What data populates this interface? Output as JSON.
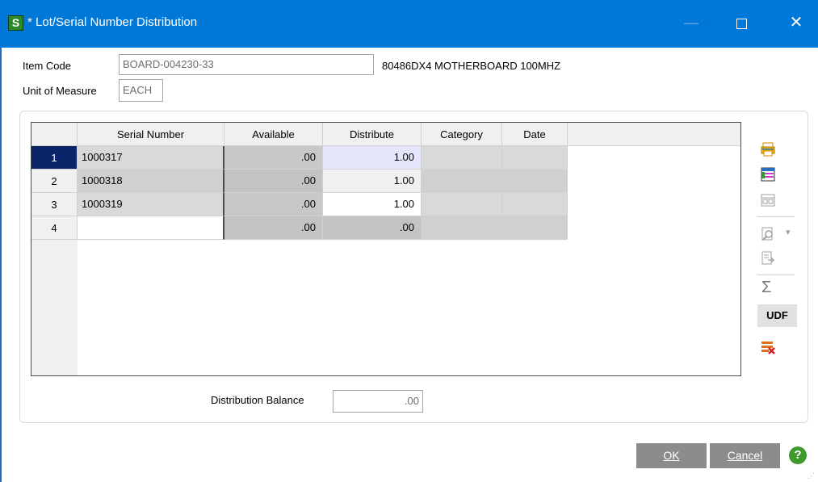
{
  "window": {
    "title": "* Lot/Serial Number Distribution",
    "app_icon_letter": "S",
    "minimize_glyph": "—",
    "close_glyph": "✕"
  },
  "header": {
    "item_code_label": "Item Code",
    "item_code_value": "BOARD-004230-33",
    "item_description": "80486DX4 MOTHERBOARD 100MHZ",
    "uom_label": "Unit of Measure",
    "uom_value": "EACH"
  },
  "grid": {
    "columns": [
      "Serial Number",
      "Available",
      "Distribute",
      "Category",
      "Date"
    ],
    "rows": [
      {
        "num": "1",
        "serial": "1000317",
        "available": ".00",
        "distribute": "1.00",
        "category": "",
        "date": ""
      },
      {
        "num": "2",
        "serial": "1000318",
        "available": ".00",
        "distribute": "1.00",
        "category": "",
        "date": ""
      },
      {
        "num": "3",
        "serial": "1000319",
        "available": ".00",
        "distribute": "1.00",
        "category": "",
        "date": ""
      },
      {
        "num": "4",
        "serial": "",
        "available": ".00",
        "distribute": ".00",
        "category": "",
        "date": ""
      }
    ],
    "selected_row": 1
  },
  "toolbar": {
    "icons": [
      "print-icon",
      "insert-rows-icon",
      "grid-layout-icon",
      "zoom-icon",
      "dropdown-arrow-icon",
      "export-icon",
      "totals-icon",
      "delete-rows-icon"
    ],
    "dropdown_glyph": "▾",
    "totals_glyph": "Σ",
    "udf_label": "UDF"
  },
  "footer": {
    "distribution_balance_label": "Distribution Balance",
    "distribution_balance_value": ".00"
  },
  "buttons": {
    "ok_label": "OK",
    "cancel_label": "Cancel",
    "help_glyph": "?"
  },
  "colors": {
    "titlebar": "#0078d7",
    "selected_row_header": "#0a246a",
    "button_bg": "#8c8c8c",
    "help_green": "#3e9a2d",
    "active_cell": "#e6e6fa"
  }
}
